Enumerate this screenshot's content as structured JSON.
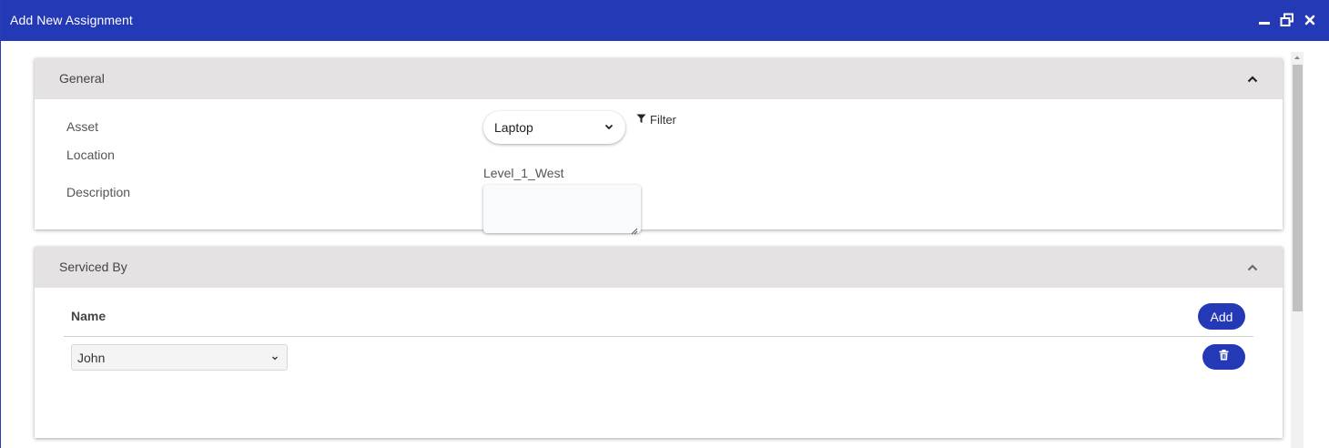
{
  "window": {
    "title": "Add New Assignment",
    "controls": [
      "minimize-icon",
      "restore-icon",
      "close-icon"
    ]
  },
  "general": {
    "header": "General",
    "asset_label": "Asset",
    "asset_value": "Laptop",
    "filter_label": "Filter",
    "location_label": "Location",
    "location_value": "Level_1_West",
    "description_label": "Description",
    "description_value": ""
  },
  "serviced_by": {
    "header": "Serviced By",
    "column_name": "Name",
    "add_label": "Add",
    "rows": [
      {
        "name": "John"
      }
    ]
  },
  "colors": {
    "titlebar": "#2439b5",
    "panel_header": "#e4e2e3",
    "button": "#2439b5"
  }
}
